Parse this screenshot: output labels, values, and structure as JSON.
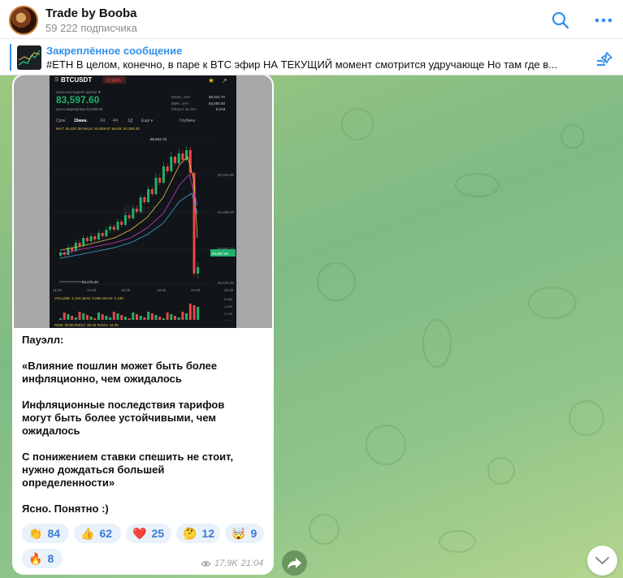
{
  "header": {
    "title": "Trade by Booba",
    "subtitle": "59 222 подписчика"
  },
  "pinned": {
    "title": "Закреплённое сообщение",
    "text": "#ETH  В целом, конечно, в паре к BTC эфир НА ТЕКУЩИЙ момент смотрится удручающе   Но там где в..."
  },
  "chart_screenshot": {
    "symbol": "BTCUSDT",
    "change": "-0.96%",
    "last_price_label": "Цена последней сделки ▼",
    "price": "83,597.60",
    "mark_price": "Цена маркировки 83,599.96",
    "stats": [
      {
        "label": "МАКС. 24Ч",
        "value": "85,522.70"
      },
      {
        "label": "МИН. 24Ч",
        "value": "83,055.00"
      },
      {
        "label": "Оборот за 24ч",
        "value": "8,218"
      }
    ],
    "timeframes": [
      "Срок",
      "15мин.",
      "1Ч",
      "4Ч",
      "1Д",
      "Ещё ▾",
      "Глубина"
    ],
    "ma_line": "MA7: 84,487.38  MA14: 84,659.97  MA28: 84,306.30",
    "high_label": "85,522.70",
    "low_label": "83,075.30",
    "current_tag": "83,597.60",
    "axis_prices": [
      "84,910.80",
      "84,299.00",
      "83,687.10",
      "83,075.30"
    ],
    "time_labels": [
      "11:00",
      "13:30",
      "16:00",
      "18:30",
      "21:00",
      "23:30"
    ],
    "volume_line": "VOLUME: 1.31K  MA5: 3.05K  MA10: 2.10K",
    "rsi_line": "RSI6: 30.95  RSI12: 38.45  RSI24: 44.35",
    "volume_axis": [
      "6.56K",
      "4.39K",
      "2.19K",
      "81.62"
    ]
  },
  "message": {
    "paragraphs": [
      "Пауэлл:",
      "«Влияние пошлин может быть более\nинфляционно, чем ожидалось",
      "Инфляционные последствия тарифов\nмогут быть более устойчивыми, чем\nожидалось",
      "С понижением ставки спешить не стоит,\nнужно дождаться большей\nопределенности»",
      "Ясно. Понятно :)"
    ],
    "reactions": [
      {
        "emoji": "👏",
        "count": "84"
      },
      {
        "emoji": "👍",
        "count": "62"
      },
      {
        "emoji": "❤️",
        "count": "25"
      },
      {
        "emoji": "🤔",
        "count": "12"
      },
      {
        "emoji": "🤯",
        "count": "9"
      },
      {
        "emoji": "🔥",
        "count": "8"
      }
    ],
    "views": "17,9K",
    "time": "21:04"
  },
  "colors": {
    "accent": "#3390ec",
    "candle_up": "#20b26c",
    "candle_down": "#ef454a"
  }
}
